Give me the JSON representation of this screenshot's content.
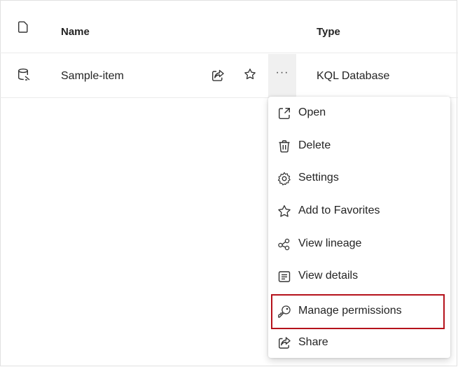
{
  "table": {
    "columns": {
      "icon": "file-icon",
      "name": "Name",
      "type": "Type"
    },
    "rows": [
      {
        "icon": "database-icon",
        "name": "Sample-item",
        "type": "KQL Database"
      }
    ]
  },
  "row_actions": {
    "share_icon": "share-icon",
    "favorite_icon": "star-icon",
    "more": "···"
  },
  "context_menu": {
    "items": [
      {
        "label": "Open",
        "icon": "open-external-icon"
      },
      {
        "label": "Delete",
        "icon": "trash-icon"
      },
      {
        "label": "Settings",
        "icon": "gear-icon"
      },
      {
        "label": "Add to Favorites",
        "icon": "star-icon"
      },
      {
        "label": "View lineage",
        "icon": "lineage-icon"
      },
      {
        "label": "View details",
        "icon": "details-icon"
      },
      {
        "label": "Manage permissions",
        "icon": "key-icon"
      },
      {
        "label": "Share",
        "icon": "share-icon"
      }
    ],
    "highlighted_item": "Manage permissions",
    "highlight_color": "#b5121b"
  }
}
